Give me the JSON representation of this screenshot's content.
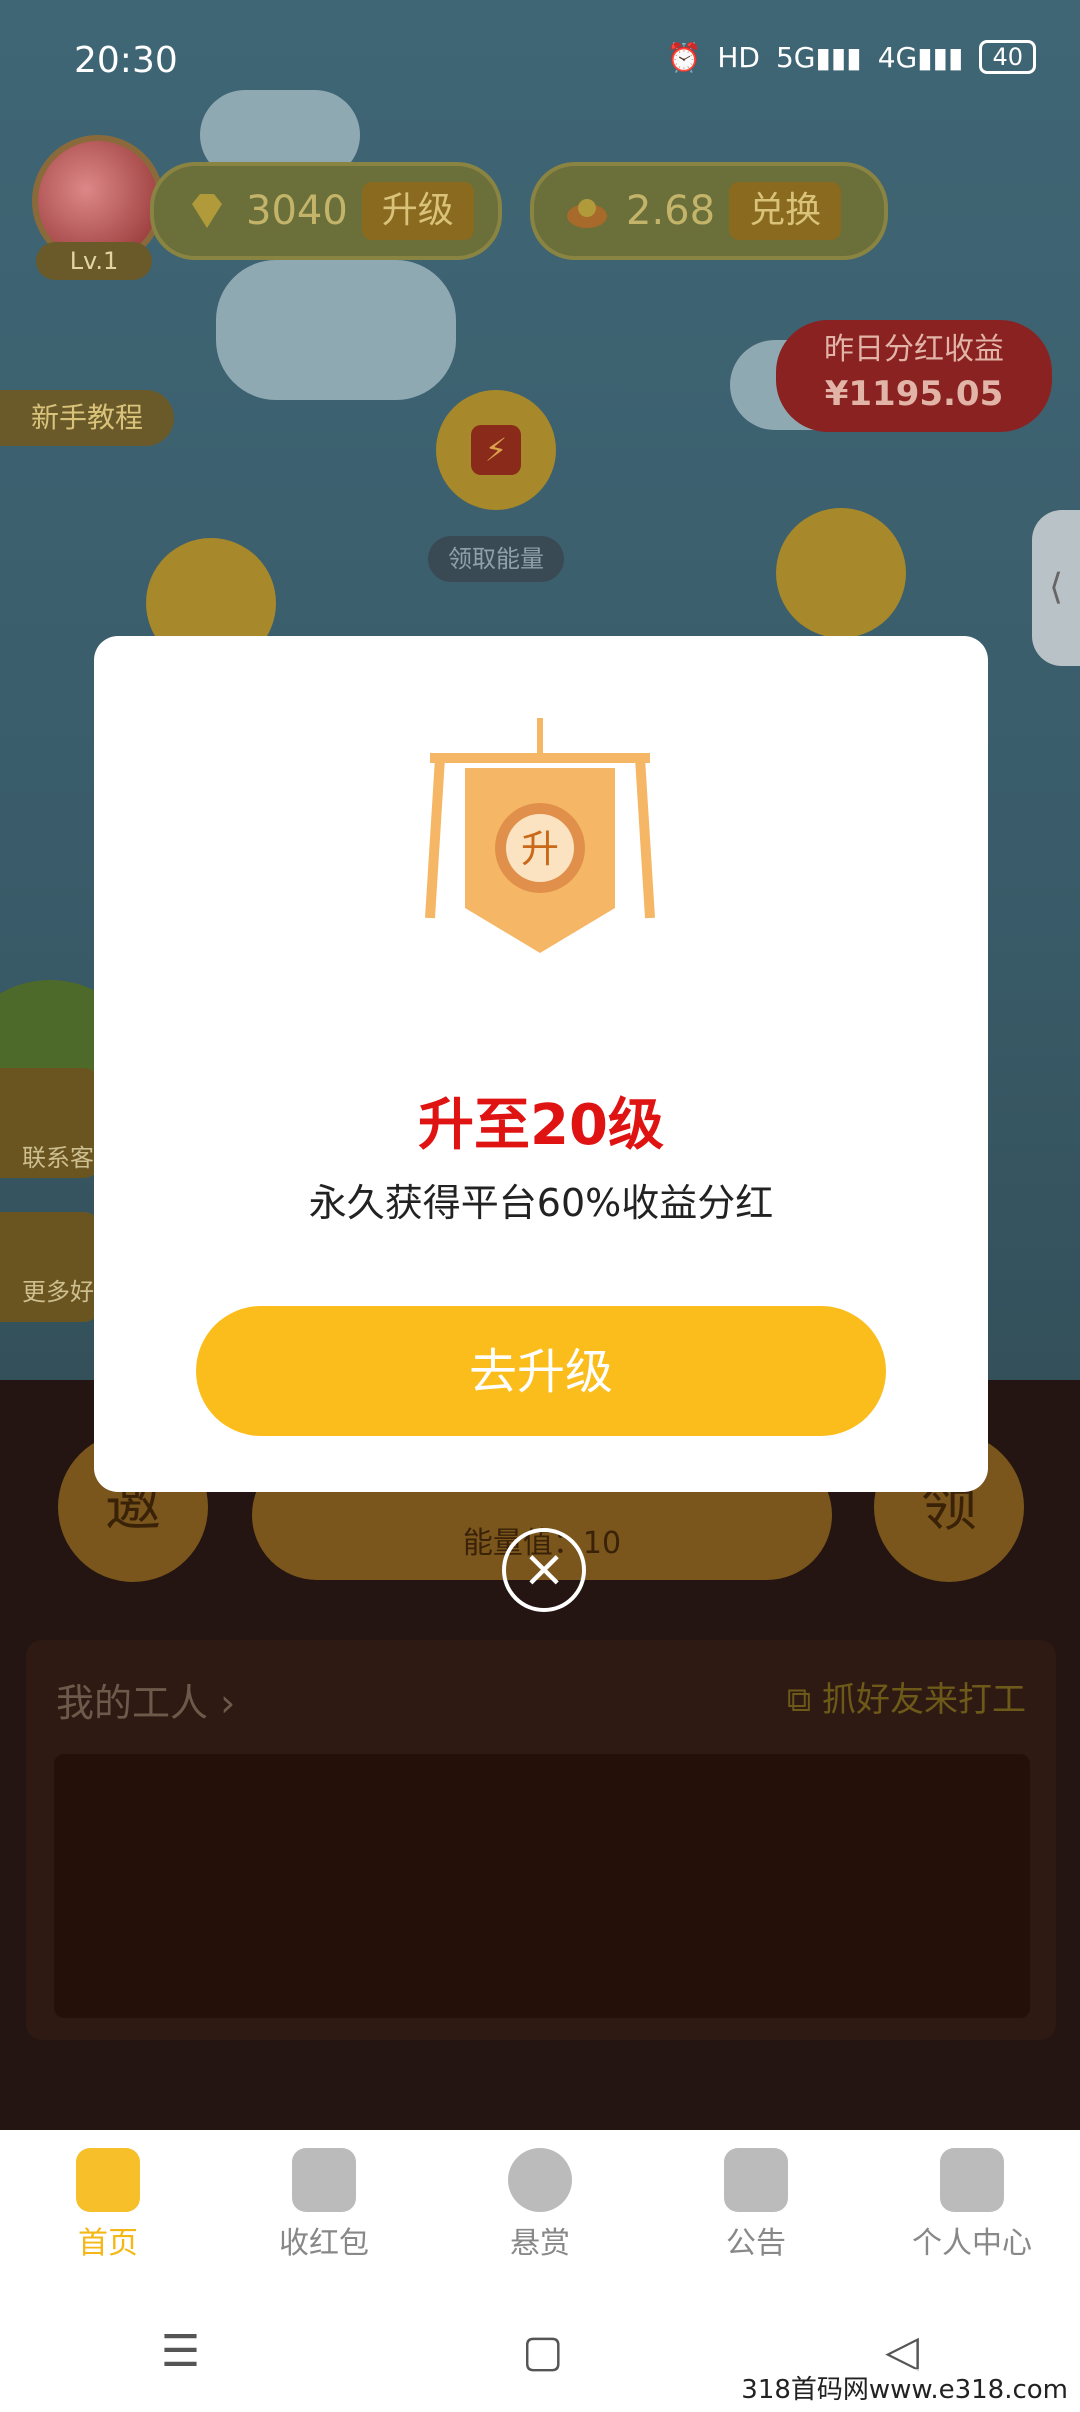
{
  "status_bar": {
    "time": "20:30",
    "icons": [
      "alarm-icon",
      "hd-icon",
      "signal-5g-icon",
      "signal-4g-icon"
    ],
    "battery": "40"
  },
  "top": {
    "level": "Lv.1",
    "diamonds": "3040",
    "upgrade_label": "升级",
    "coins": "2.68",
    "exchange_label": "兑换"
  },
  "dividend": {
    "label": "昨日分红收益",
    "value": "¥1195.05"
  },
  "tutorial_label": "新手教程",
  "energy_label": "领取能量",
  "side": {
    "contact": "联系客",
    "more": "更多好"
  },
  "bottom_game": {
    "invite_char": "邀",
    "claim_char": "领",
    "energy_text": "能量值：10"
  },
  "workers": {
    "title": "我的工人",
    "invite": "抓好友来打工"
  },
  "modal": {
    "title": "升至20级",
    "subtitle": "永久获得平台60%收益分红",
    "button": "去升级",
    "banner_char": "升"
  },
  "nav": {
    "items": [
      {
        "label": "首页",
        "icon": "home-icon"
      },
      {
        "label": "收红包",
        "icon": "red-packet-icon"
      },
      {
        "label": "悬赏",
        "icon": "money-bag-icon"
      },
      {
        "label": "公告",
        "icon": "notice-icon"
      },
      {
        "label": "个人中心",
        "icon": "profile-icon"
      }
    ]
  },
  "system_nav": {
    "menu": "☰",
    "home": "▢",
    "back": "◁"
  },
  "watermark": "318首码网www.e318.com",
  "colors": {
    "accent": "#fbbd1c",
    "title_red": "#e01313",
    "nav_active": "#f5b718"
  }
}
